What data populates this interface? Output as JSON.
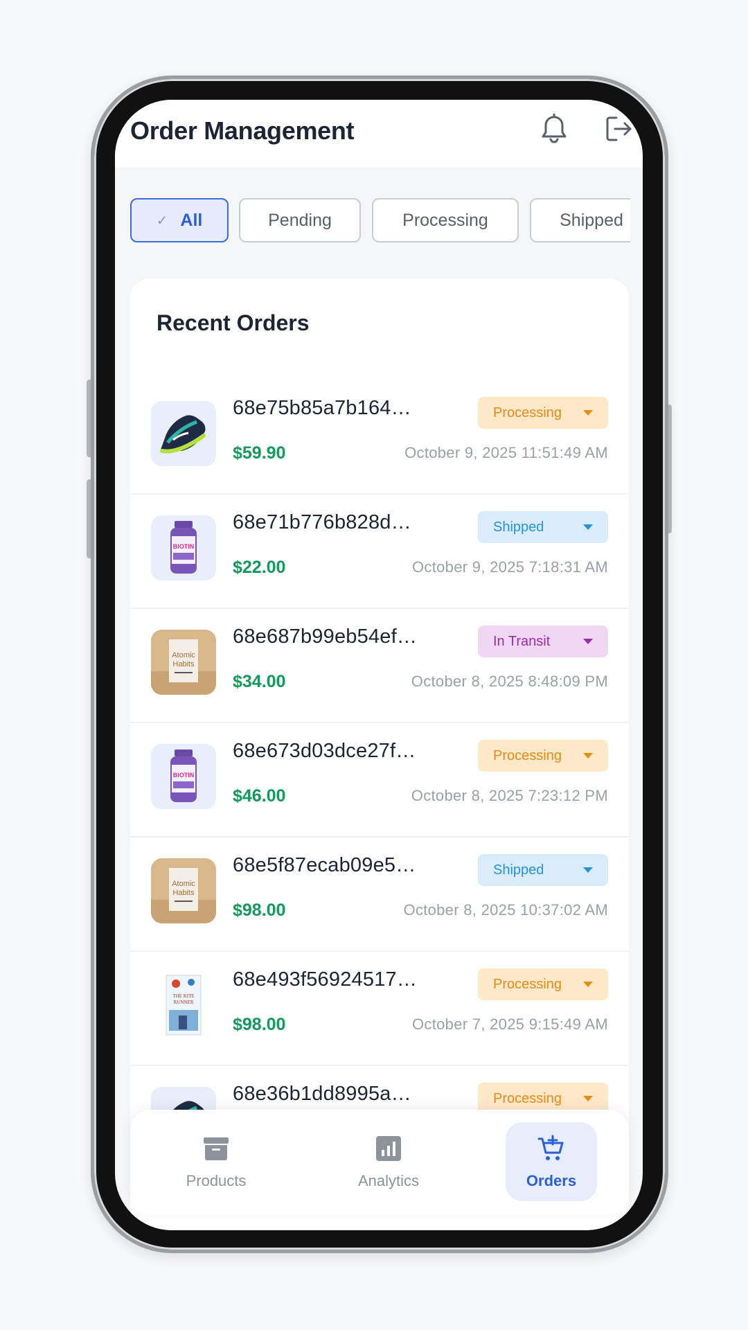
{
  "header": {
    "title": "Order Management"
  },
  "filters": [
    "All",
    "Pending",
    "Processing",
    "Shipped"
  ],
  "orders_section": {
    "title": "Recent Orders"
  },
  "orders": [
    {
      "id": "68e75b85a7b164…",
      "price": "$59.90",
      "date": "October 9, 2025 11:51:49 AM",
      "status": "Processing",
      "product": "sneaker"
    },
    {
      "id": "68e71b776b828d…",
      "price": "$22.00",
      "date": "October 9, 2025 7:18:31 AM",
      "status": "Shipped",
      "product": "biotin"
    },
    {
      "id": "68e687b99eb54ef…",
      "price": "$34.00",
      "date": "October 8, 2025 8:48:09 PM",
      "status": "In Transit",
      "product": "atomic-habits"
    },
    {
      "id": "68e673d03dce27f…",
      "price": "$46.00",
      "date": "October 8, 2025 7:23:12 PM",
      "status": "Processing",
      "product": "biotin"
    },
    {
      "id": "68e5f87ecab09e5…",
      "price": "$98.00",
      "date": "October 8, 2025 10:37:02 AM",
      "status": "Shipped",
      "product": "atomic-habits"
    },
    {
      "id": "68e493f56924517…",
      "price": "$98.00",
      "date": "October 7, 2025 9:15:49 AM",
      "status": "Processing",
      "product": "kite-runner"
    },
    {
      "id": "68e36b1dd8995a…",
      "price": "",
      "date": "",
      "status": "Processing",
      "product": "sneaker"
    }
  ],
  "thumb_text": {
    "biotin": "BIOTIN",
    "atomic": "Atomic",
    "habits": "Habits",
    "kite": "THE KITE",
    "runner": "RUNNER"
  },
  "bottom_nav": [
    {
      "label": "Products",
      "icon": "archive-icon",
      "active": false
    },
    {
      "label": "Analytics",
      "icon": "analytics-icon",
      "active": false
    },
    {
      "label": "Orders",
      "icon": "cart-icon",
      "active": true
    }
  ],
  "colors": {
    "accent": "#2a5fd6",
    "price": "#139a5c",
    "processing": "#e78b17",
    "shipped": "#2892d8",
    "in_transit": "#9b2cae"
  }
}
